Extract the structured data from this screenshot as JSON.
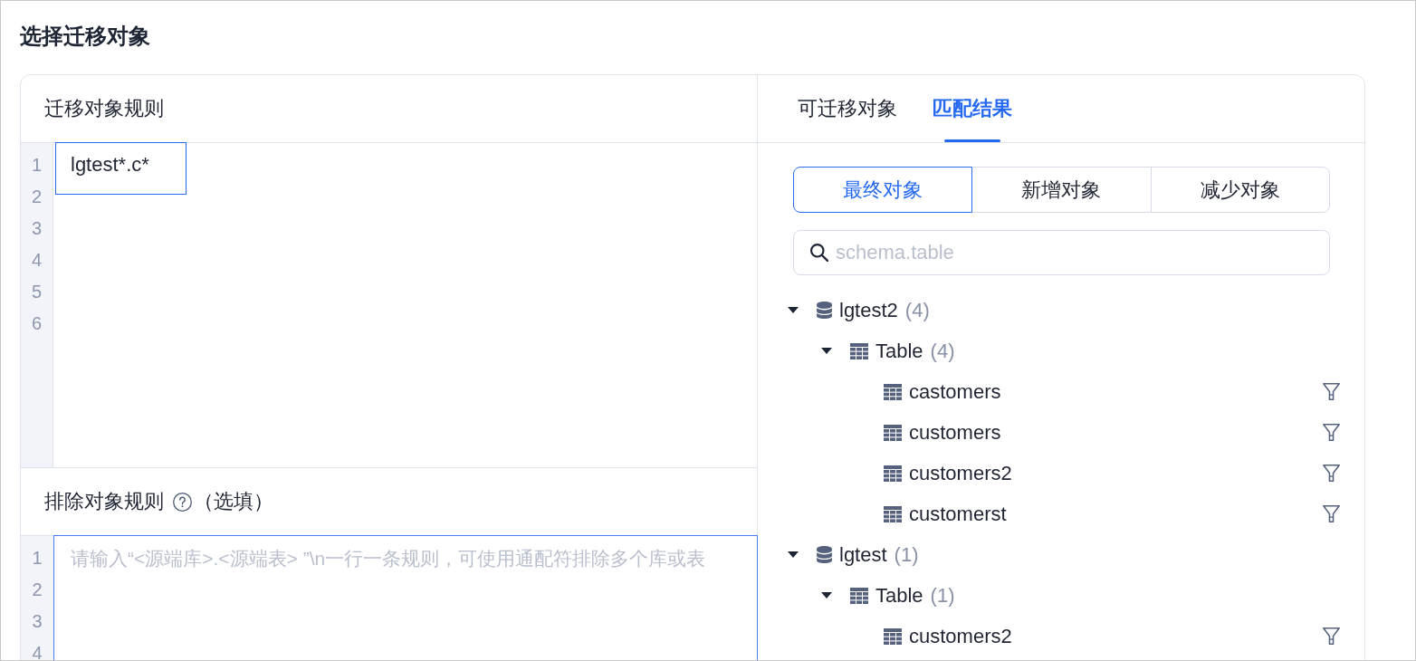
{
  "page": {
    "title": "选择迁移对象"
  },
  "rules": {
    "title": "迁移对象规则",
    "line_numbers": [
      "1",
      "2",
      "3",
      "4",
      "5",
      "6"
    ],
    "lines": [
      "lgtest*.c*"
    ]
  },
  "exclude_rules": {
    "title": "排除对象规则",
    "note": "（选填）",
    "line_numbers": [
      "1",
      "2",
      "3",
      "4"
    ],
    "placeholder": "请输入“<源端库>.<源端表> ”\\n一行一条规则，可使用通配符排除多个库或表"
  },
  "tabs": [
    {
      "label": "可迁移对象",
      "selected": false
    },
    {
      "label": "匹配结果",
      "selected": true
    }
  ],
  "segments": [
    {
      "label": "最终对象",
      "selected": true
    },
    {
      "label": "新增对象",
      "selected": false
    },
    {
      "label": "减少对象",
      "selected": false
    }
  ],
  "search": {
    "placeholder": "schema.table"
  },
  "tree": [
    {
      "kind": "database",
      "name": "lgtest2",
      "count": "(4)",
      "expanded": true,
      "children": [
        {
          "kind": "category",
          "name": "Table",
          "count": "(4)",
          "expanded": true,
          "children": [
            {
              "kind": "table",
              "name": "castomers"
            },
            {
              "kind": "table",
              "name": "customers"
            },
            {
              "kind": "table",
              "name": "customers2"
            },
            {
              "kind": "table",
              "name": "customerst"
            }
          ]
        }
      ]
    },
    {
      "kind": "database",
      "name": "lgtest",
      "count": "(1)",
      "expanded": true,
      "children": [
        {
          "kind": "category",
          "name": "Table",
          "count": "(1)",
          "expanded": true,
          "children": [
            {
              "kind": "table",
              "name": "customers2"
            }
          ]
        }
      ]
    }
  ]
}
